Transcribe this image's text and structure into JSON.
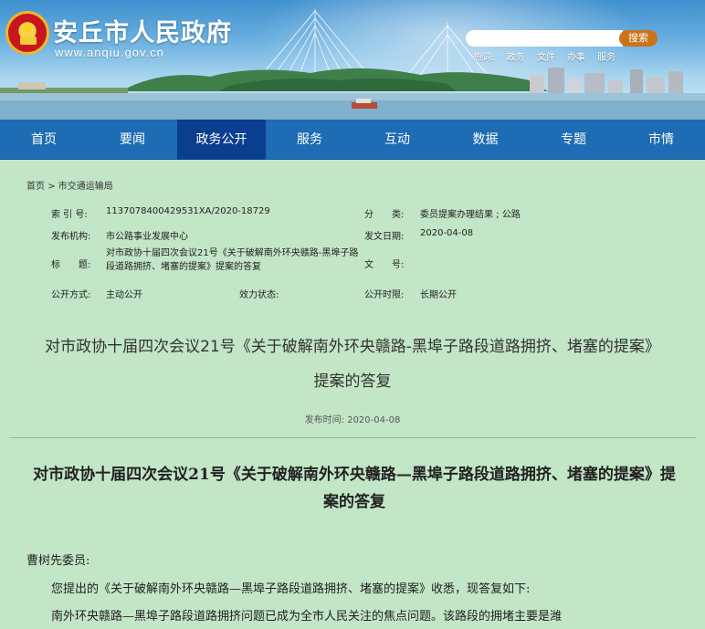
{
  "header": {
    "site_title": "安丘市人民政府",
    "site_url": "www.anqiu.gov.cn",
    "search_button": "搜索",
    "search_placeholder": "",
    "hot_label": "热词:",
    "hot_words": [
      "政务",
      "文件",
      "办事",
      "服务"
    ]
  },
  "nav": {
    "items": [
      "首页",
      "要闻",
      "政务公开",
      "服务",
      "互动",
      "数据",
      "专题",
      "市情"
    ],
    "active_index": 2
  },
  "breadcrumb": [
    "首页",
    "市交通运输局"
  ],
  "breadcrumb_sep": ">",
  "meta": {
    "index_label": "索 引 号:",
    "index_value": "1137078400429531XA/2020-18729",
    "category_label": "分　　类:",
    "category_value": "委员提案办理结果 ; 公路",
    "org_label": "发布机构:",
    "org_value": "市公路事业发展中心",
    "date_label": "发文日期:",
    "date_value": "2020-04-08",
    "title_label": "标　　题:",
    "title_value": "对市政协十届四次会议21号《关于破解南外环央赣路-黑埠子路段道路拥挤、堵塞的提案》提案的答复",
    "docno_label": "文　　号:",
    "docno_value": "",
    "mode_label": "公开方式:",
    "mode_value": "主动公开",
    "validity_label": "效力状态:",
    "validity_value": "",
    "period_label": "公开时限:",
    "period_value": "长期公开"
  },
  "article": {
    "title_line1": "对市政协十届四次会议21号《关于破解南外环央赣路-黑埠子路段道路拥挤、堵塞的提案》",
    "title_line2": "提案的答复",
    "pubtime": "发布时间:  2020-04-08",
    "doc_title": "对市政协十届四次会议21号《关于破解南外环央赣路—黑埠子路段道路拥挤、堵塞的提案》提案的答复",
    "salutation": "曹树先委员:",
    "para1": "您提出的《关于破解南外环央赣路—黑埠子路段道路拥挤、堵塞的提案》收悉，现答复如下:",
    "para2": "南外环央赣路—黑埠子路段道路拥挤问题已成为全市人民关注的焦点问题。该路段的拥堵主要是潍"
  }
}
